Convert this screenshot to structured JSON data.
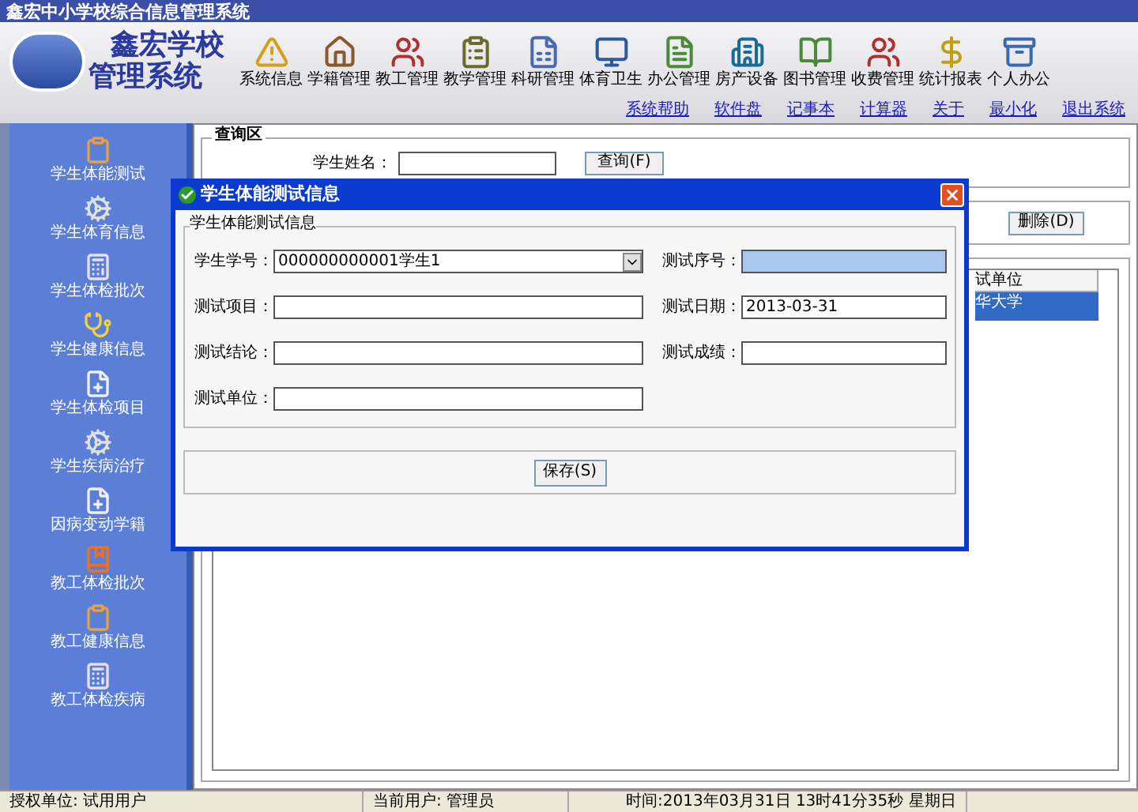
{
  "window": {
    "title": "鑫宏中小学校综合信息管理系统"
  },
  "header": {
    "title_line1": "鑫宏学校",
    "title_line2": "管理系统"
  },
  "toolbar": [
    "系统信息",
    "学籍管理",
    "教工管理",
    "教学管理",
    "科研管理",
    "体育卫生",
    "办公管理",
    "房产设备",
    "图书管理",
    "收费管理",
    "统计报表",
    "个人办公"
  ],
  "links": [
    "系统帮助",
    "软件盘",
    "记事本",
    "计算器",
    "关于",
    "最小化",
    "退出系统"
  ],
  "sidebar": {
    "items": [
      {
        "label": "学生体能测试"
      },
      {
        "label": "学生体育信息"
      },
      {
        "label": "学生体检批次"
      },
      {
        "label": "学生健康信息"
      },
      {
        "label": "学生体检项目"
      },
      {
        "label": "学生疾病治疗"
      },
      {
        "label": "因病变动学籍"
      },
      {
        "label": "教工体检批次"
      },
      {
        "label": "教工健康信息"
      },
      {
        "label": "教工体检疾病"
      }
    ]
  },
  "query": {
    "legend": "查询区",
    "label": "学生姓名：",
    "button": "查询(F)"
  },
  "actions": {
    "button": "删除(D)"
  },
  "table": {
    "columns": [
      "试单位"
    ],
    "rows": [
      {
        "cells": [
          "华大学"
        ],
        "selected": true
      }
    ]
  },
  "dialog": {
    "title": "学生体能测试信息",
    "group": "学生体能测试信息",
    "save_button": "保存(S)",
    "fields": [
      {
        "label": "学生学号：",
        "value": "000000000001学生1",
        "kind": "combo",
        "focused": false
      },
      {
        "label": "测试序号：",
        "kind": "text",
        "focused": true
      },
      {
        "label": "测试项目：",
        "kind": "text",
        "focused": false
      },
      {
        "label": "测试日期：",
        "value": "2013-03-31",
        "kind": "text",
        "focused": false
      },
      {
        "label": "测试结论：",
        "kind": "text",
        "focused": false
      },
      {
        "label": "测试成绩：",
        "kind": "text",
        "focused": false
      },
      {
        "label": "测试单位：",
        "kind": "text",
        "focused": false
      }
    ]
  },
  "status_bar": [
    "授权单位: 试用用户",
    "当前用户: 管理员",
    "时间:2013年03月31日 13时41分35秒 星期日"
  ]
}
